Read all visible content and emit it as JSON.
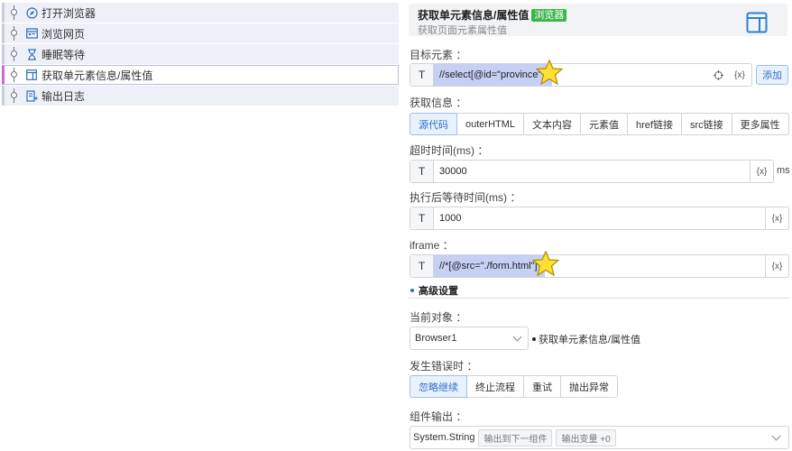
{
  "flow": {
    "items": [
      {
        "label": "打开浏览器",
        "icon": "compass-icon"
      },
      {
        "label": "浏览网页",
        "icon": "browser-window-icon"
      },
      {
        "label": "睡眠等待",
        "icon": "hourglass-icon"
      },
      {
        "label": "获取单元素信息/属性值",
        "icon": "element-panel-icon",
        "selected": true
      },
      {
        "label": "输出日志",
        "icon": "log-output-icon"
      }
    ]
  },
  "header": {
    "title": "获取单元素信息/属性值",
    "badge": "浏览器",
    "subtitle": "获取页面元素属性值",
    "icon": "element-panel-icon",
    "accent": "#2f80d0"
  },
  "target_element": {
    "label": "目标元素 ：",
    "prefix": "T",
    "value": "//select[@id=\"province\"]",
    "var_button": "{x}",
    "add_button": "添加"
  },
  "get_info": {
    "label": "获取信息 ：",
    "options": [
      "源代码",
      "outerHTML",
      "文本内容",
      "元素值",
      "href链接",
      "src链接",
      "更多属性"
    ],
    "selected": "源代码"
  },
  "timeout": {
    "label": "超时时间(ms) ：",
    "prefix": "T",
    "value": "30000",
    "var_button": "{x}",
    "unit": "ms"
  },
  "wait_after": {
    "label": "执行后等待时间(ms) ：",
    "prefix": "T",
    "value": "1000",
    "var_button": "{x}"
  },
  "iframe": {
    "label": "iframe ：",
    "prefix": "T",
    "value": "//*[@src=\"./form.html\"]",
    "var_button": "{x}"
  },
  "advanced": {
    "title": "高级设置"
  },
  "current_object": {
    "label": "当前对象 ：",
    "value": "Browser1",
    "note": "获取单元素信息/属性值"
  },
  "on_error": {
    "label": "发生错误时 ：",
    "options": [
      "忽略继续",
      "终止流程",
      "重试",
      "抛出异常"
    ],
    "selected": "忽略继续"
  },
  "output": {
    "label": "组件输出 ：",
    "type": "System.String",
    "tags": [
      "输出到下一组件",
      "输出变量 +0"
    ]
  }
}
